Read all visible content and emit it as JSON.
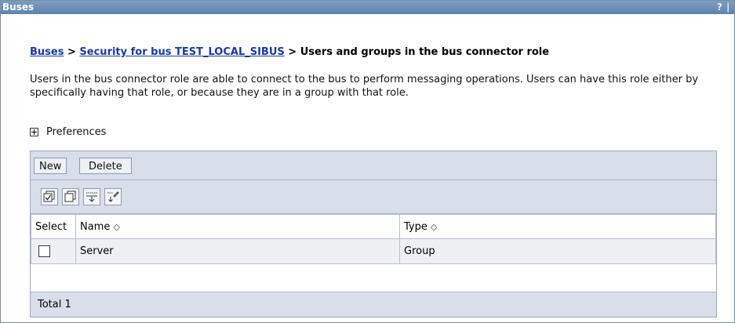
{
  "window": {
    "title": "Buses",
    "help_label": "? ∣"
  },
  "breadcrumb": {
    "link1": "Buses",
    "sep1": " > ",
    "link2": "Security for bus TEST_LOCAL_SIBUS",
    "sep2": " > ",
    "current": "Users and groups in the bus connector role"
  },
  "description": "Users in the bus connector role are able to connect to the bus to perform messaging operations. Users can have this role either by specifically having that role, or because they are in a group with that role.",
  "preferences": {
    "label": "Preferences",
    "expanded": false
  },
  "toolbar": {
    "new_label": "New",
    "delete_label": "Delete"
  },
  "icon_toolbar": {
    "icons": [
      "select-all-icon",
      "deselect-all-icon",
      "show-filter-icon",
      "clear-filter-icon"
    ]
  },
  "table": {
    "headers": {
      "select": "Select",
      "name": "Name",
      "type": "Type"
    },
    "sort_glyph": "◇",
    "rows": [
      {
        "name": "Server",
        "type": "Group",
        "checked": false
      }
    ],
    "total": "Total 1"
  },
  "colors": {
    "titlebar": "#6b8fb8",
    "link": "#1a3aa0",
    "toolbar_bg": "#d8deea",
    "row_bg": "#eef0f4"
  }
}
